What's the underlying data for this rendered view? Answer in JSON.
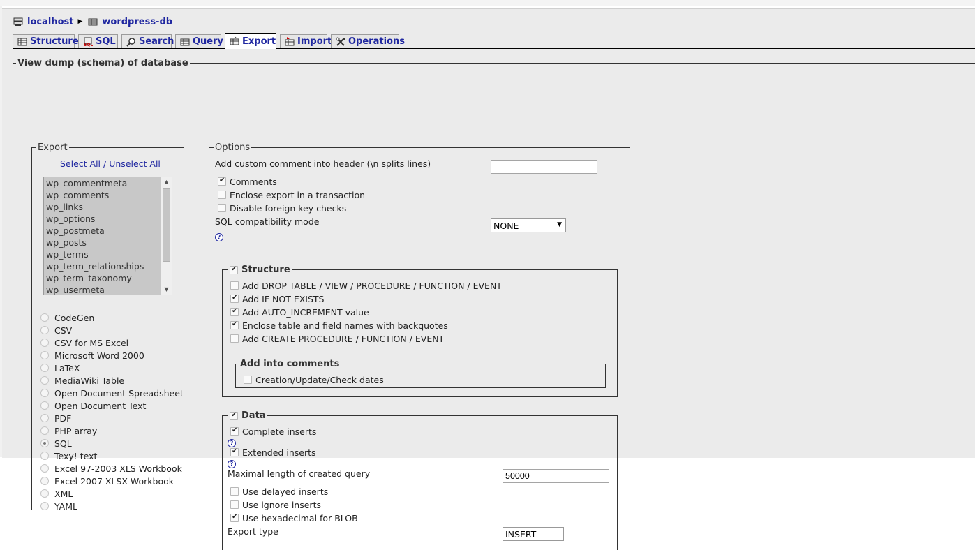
{
  "breadcrumb": {
    "server": "localhost",
    "database": "wordpress-db"
  },
  "tabs": [
    {
      "label": "Structure",
      "icon": "structure-icon",
      "active": false
    },
    {
      "label": "SQL",
      "icon": "sql-icon",
      "active": false
    },
    {
      "label": "Search",
      "icon": "search-icon",
      "active": false
    },
    {
      "label": "Query",
      "icon": "query-icon",
      "active": false
    },
    {
      "label": "Export",
      "icon": "export-icon",
      "active": true
    },
    {
      "label": "Import",
      "icon": "import-icon",
      "active": false
    },
    {
      "label": "Operations",
      "icon": "operations-icon",
      "active": false
    }
  ],
  "main": {
    "legend": "View dump (schema) of database"
  },
  "export": {
    "legend": "Export",
    "select_all": "Select All",
    "separator": " / ",
    "unselect_all": "Unselect All",
    "tables": [
      "wp_commentmeta",
      "wp_comments",
      "wp_links",
      "wp_options",
      "wp_postmeta",
      "wp_posts",
      "wp_terms",
      "wp_term_relationships",
      "wp_term_taxonomy",
      "wp_usermeta"
    ],
    "formats": [
      {
        "label": "CodeGen",
        "selected": false
      },
      {
        "label": "CSV",
        "selected": false
      },
      {
        "label": "CSV for MS Excel",
        "selected": false
      },
      {
        "label": "Microsoft Word 2000",
        "selected": false
      },
      {
        "label": "LaTeX",
        "selected": false
      },
      {
        "label": "MediaWiki Table",
        "selected": false
      },
      {
        "label": "Open Document Spreadsheet",
        "selected": false
      },
      {
        "label": "Open Document Text",
        "selected": false
      },
      {
        "label": "PDF",
        "selected": false
      },
      {
        "label": "PHP array",
        "selected": false
      },
      {
        "label": "SQL",
        "selected": true
      },
      {
        "label": "Texy! text",
        "selected": false
      },
      {
        "label": "Excel 97-2003 XLS Workbook",
        "selected": false
      },
      {
        "label": "Excel 2007 XLSX Workbook",
        "selected": false
      },
      {
        "label": "XML",
        "selected": false
      },
      {
        "label": "YAML",
        "selected": false
      }
    ]
  },
  "options": {
    "legend": "Options",
    "custom_comment_label": "Add custom comment into header (\\n splits lines)",
    "custom_comment_value": "",
    "comments": {
      "label": "Comments",
      "checked": true
    },
    "transaction": {
      "label": "Enclose export in a transaction",
      "checked": false
    },
    "foreign_keys": {
      "label": "Disable foreign key checks",
      "checked": false
    },
    "compat_label": "SQL compatibility mode",
    "compat_value": "NONE",
    "help_glyph": "?",
    "structure": {
      "legend": "Structure",
      "checked": true,
      "drop_table": {
        "label": "Add DROP TABLE / VIEW / PROCEDURE / FUNCTION / EVENT",
        "checked": false
      },
      "if_not_exists": {
        "label": "Add IF NOT EXISTS",
        "checked": true
      },
      "auto_increment": {
        "label": "Add AUTO_INCREMENT value",
        "checked": true
      },
      "backquotes": {
        "label": "Enclose table and field names with backquotes",
        "checked": true
      },
      "create_procedure": {
        "label": "Add CREATE PROCEDURE / FUNCTION / EVENT",
        "checked": false
      },
      "comments_legend": "Add into comments",
      "dates": {
        "label": "Creation/Update/Check dates",
        "checked": false
      }
    },
    "data": {
      "legend": "Data",
      "checked": true,
      "complete_inserts": {
        "label": "Complete inserts",
        "checked": true
      },
      "extended_inserts": {
        "label": "Extended inserts",
        "checked": true
      },
      "max_query_label": "Maximal length of created query",
      "max_query_value": "50000",
      "delayed": {
        "label": "Use delayed inserts",
        "checked": false
      },
      "ignore": {
        "label": "Use ignore inserts",
        "checked": false
      },
      "hex_blob": {
        "label": "Use hexadecimal for BLOB",
        "checked": true
      },
      "export_type_label": "Export type",
      "export_type_value": "INSERT"
    }
  }
}
